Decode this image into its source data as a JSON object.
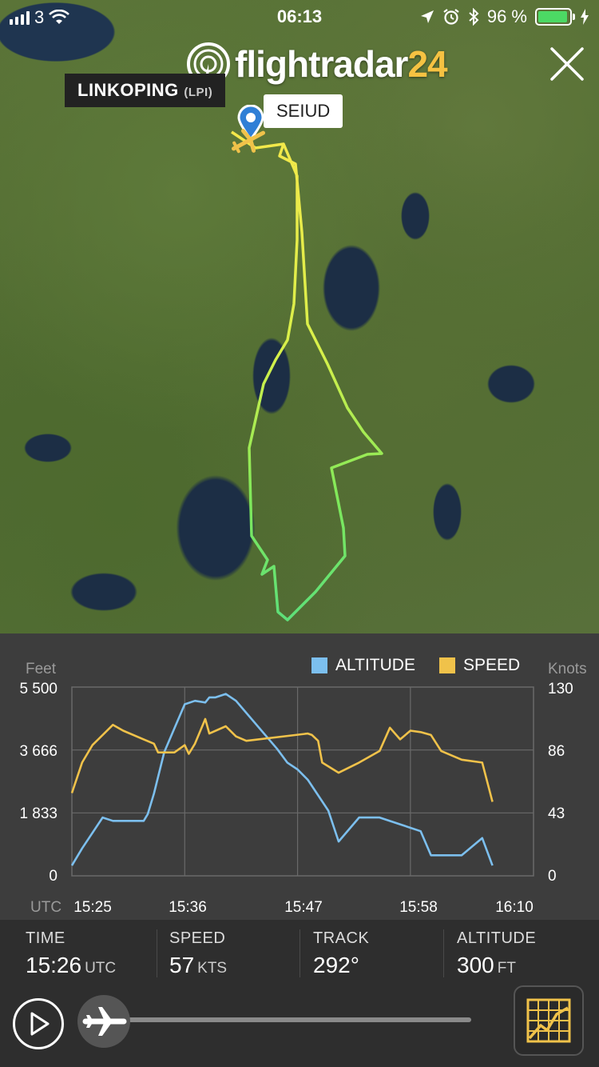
{
  "status_bar": {
    "carrier": "3",
    "time": "06:13",
    "battery_percent": "96 %",
    "battery_level": 0.96
  },
  "header": {
    "brand_text": "flightradar",
    "brand_number": "24"
  },
  "map": {
    "airport_label": "LINKOPING",
    "airport_code": "(LPI)",
    "callsign": "SEIUD"
  },
  "chart": {
    "left_unit": "Feet",
    "right_unit": "Knots",
    "legend_altitude": "ALTITUDE",
    "legend_speed": "SPEED",
    "utc_label": "UTC",
    "altitude_ticks": [
      "5 500",
      "3 666",
      "1 833",
      "0"
    ],
    "speed_ticks": [
      "130",
      "86",
      "43",
      "0"
    ],
    "time_ticks": [
      "15:25",
      "15:36",
      "15:47",
      "15:58",
      "16:10"
    ],
    "colors": {
      "altitude": "#7cbfee",
      "speed": "#f0c24a"
    }
  },
  "chart_data": {
    "type": "line",
    "title": "",
    "xlabel": "UTC",
    "ylabel": "Feet",
    "ylabel_right": "Knots",
    "xlim": [
      "15:25",
      "16:10"
    ],
    "ylim": [
      0,
      5500
    ],
    "ylim_right": [
      0,
      130
    ],
    "grid": true,
    "legend_position": "top-right",
    "series": [
      {
        "name": "ALTITUDE",
        "axis": "left",
        "color": "#7cbfee",
        "points": [
          [
            "15:25",
            300
          ],
          [
            "15:26",
            800
          ],
          [
            "15:28",
            1700
          ],
          [
            "15:29",
            1600
          ],
          [
            "15:31",
            1600
          ],
          [
            "15:32",
            1600
          ],
          [
            "15:32",
            1800
          ],
          [
            "15:33",
            2400
          ],
          [
            "15:34",
            3600
          ],
          [
            "15:35",
            4300
          ],
          [
            "15:36",
            5000
          ],
          [
            "15:37",
            5100
          ],
          [
            "15:38",
            5050
          ],
          [
            "15:38",
            5200
          ],
          [
            "15:39",
            5200
          ],
          [
            "15:40",
            5300
          ],
          [
            "15:41",
            5100
          ],
          [
            "15:45",
            3700
          ],
          [
            "15:46",
            3300
          ],
          [
            "15:47",
            3100
          ],
          [
            "15:48",
            2800
          ],
          [
            "15:50",
            1900
          ],
          [
            "15:51",
            1000
          ],
          [
            "15:53",
            1700
          ],
          [
            "15:55",
            1700
          ],
          [
            "15:57",
            1500
          ],
          [
            "15:59",
            1300
          ],
          [
            "16:00",
            600
          ],
          [
            "16:03",
            600
          ],
          [
            "16:05",
            1100
          ],
          [
            "16:06",
            300
          ]
        ]
      },
      {
        "name": "SPEED",
        "axis": "right",
        "color": "#f0c24a",
        "points": [
          [
            "15:25",
            57
          ],
          [
            "15:26",
            78
          ],
          [
            "15:27",
            90
          ],
          [
            "15:29",
            104
          ],
          [
            "15:30",
            100
          ],
          [
            "15:32",
            94
          ],
          [
            "15:33",
            91
          ],
          [
            "15:33",
            85
          ],
          [
            "15:35",
            85
          ],
          [
            "15:36",
            90
          ],
          [
            "15:36",
            84
          ],
          [
            "15:37",
            91
          ],
          [
            "15:38",
            108
          ],
          [
            "15:38",
            98
          ],
          [
            "15:40",
            103
          ],
          [
            "15:41",
            96
          ],
          [
            "15:42",
            93
          ],
          [
            "15:48",
            98
          ],
          [
            "15:48",
            97
          ],
          [
            "15:49",
            93
          ],
          [
            "15:49",
            78
          ],
          [
            "15:51",
            71
          ],
          [
            "15:53",
            78
          ],
          [
            "15:55",
            86
          ],
          [
            "15:56",
            102
          ],
          [
            "15:57",
            94
          ],
          [
            "15:58",
            100
          ],
          [
            "15:59",
            99
          ],
          [
            "16:00",
            97
          ],
          [
            "16:01",
            86
          ],
          [
            "16:03",
            80
          ],
          [
            "16:05",
            78
          ],
          [
            "16:06",
            51
          ]
        ]
      }
    ]
  },
  "info": {
    "time_label": "TIME",
    "time_value": "15:26",
    "time_unit": "UTC",
    "speed_label": "SPEED",
    "speed_value": "57",
    "speed_unit": "KTS",
    "track_label": "TRACK",
    "track_value": "292°",
    "altitude_label": "ALTITUDE",
    "altitude_value": "300",
    "altitude_unit": "FT"
  }
}
